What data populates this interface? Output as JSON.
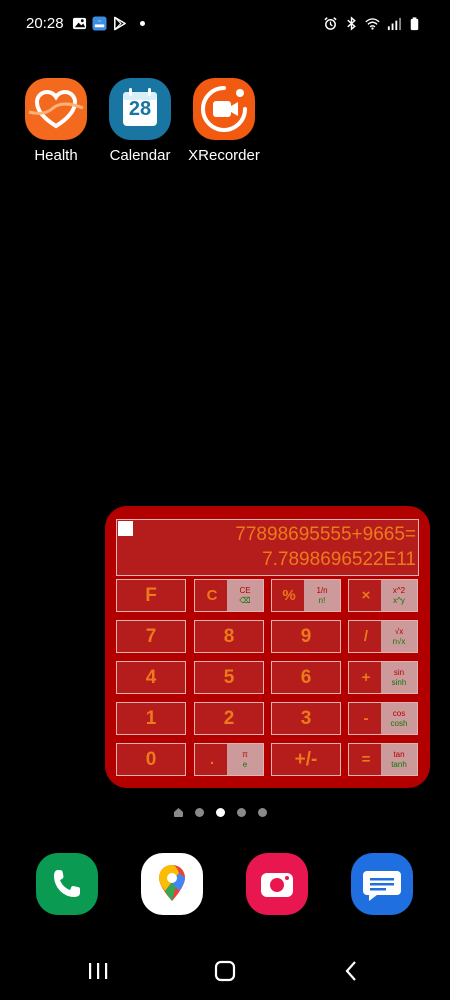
{
  "status_bar": {
    "time": "20:28",
    "left_icons": [
      "gallery-icon",
      "weather-icon",
      "play-store-icon",
      "notification-dot-icon"
    ],
    "right_icons": [
      "alarm-icon",
      "bluetooth-icon",
      "wifi-icon",
      "signal-icon",
      "battery-icon"
    ]
  },
  "home_apps": [
    {
      "label": "Health",
      "icon": "health-heart-icon",
      "color": "#f36a1f"
    },
    {
      "label": "Calendar",
      "icon": "calendar-icon",
      "day": "28",
      "color": "#1976a3"
    },
    {
      "label": "XRecorder",
      "icon": "recorder-icon",
      "color": "#f25a12"
    }
  ],
  "calculator": {
    "expression": "77898695555+9665=",
    "result": "7.7898696522E11",
    "colors": {
      "body": "#b20000",
      "text": "#ec7a1a",
      "secondary": "#0a7a0a"
    },
    "keys": {
      "f": "F",
      "c": {
        "main": "C",
        "top": "CE",
        "bottom": "⌫"
      },
      "percent": {
        "main": "%",
        "top": "1/n",
        "bottom": "n!"
      },
      "multiply": {
        "main": "×",
        "top": "x^2",
        "bottom": "x^y"
      },
      "seven": "7",
      "eight": "8",
      "nine": "9",
      "divide": {
        "main": "/",
        "top": "√x",
        "bottom": "n√x"
      },
      "four": "4",
      "five": "5",
      "six": "6",
      "plus": {
        "main": "+",
        "top": "sin",
        "bottom": "sinh"
      },
      "one": "1",
      "two": "2",
      "three": "3",
      "minus": {
        "main": "-",
        "top": "cos",
        "bottom": "cosh"
      },
      "zero": "0",
      "dot": {
        "main": ".",
        "top": "π",
        "bottom": "e"
      },
      "sign": "+/-",
      "equals": {
        "main": "=",
        "top": "tan",
        "bottom": "tanh"
      }
    }
  },
  "pager": {
    "pages": 5,
    "active_page": 3
  },
  "dock": [
    {
      "icon": "phone-icon",
      "color": "#0a9a52"
    },
    {
      "icon": "maps-icon",
      "color": "#ffffff"
    },
    {
      "icon": "camera-icon",
      "color": "#e8174f"
    },
    {
      "icon": "messages-icon",
      "color": "#1f6fe0"
    }
  ],
  "nav_bar": [
    "recents-icon",
    "home-icon",
    "back-icon"
  ]
}
